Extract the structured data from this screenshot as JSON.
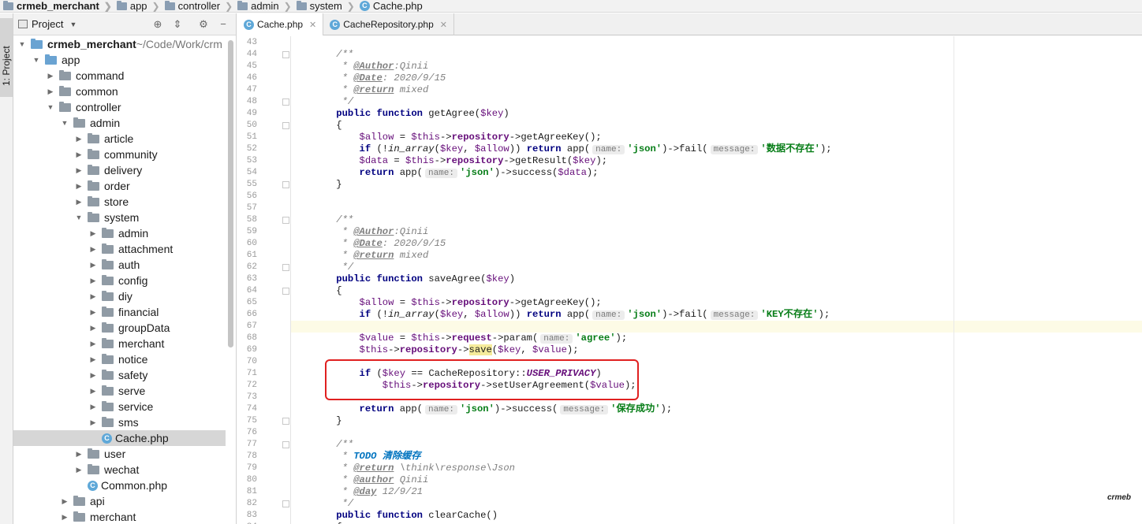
{
  "breadcrumb": [
    "crmeb_merchant",
    "app",
    "controller",
    "admin",
    "system",
    "Cache.php"
  ],
  "toolstrip": {
    "project_label": "1: Project"
  },
  "panel": {
    "title": "Project"
  },
  "tree": [
    {
      "label": "crmeb_merchant",
      "suffix": " ~/Code/Work/crm",
      "depth": 0,
      "arrow": "down",
      "type": "folder-blue",
      "bold": true
    },
    {
      "label": "app",
      "depth": 1,
      "arrow": "down",
      "type": "folder-blue"
    },
    {
      "label": "command",
      "depth": 2,
      "arrow": "right",
      "type": "folder"
    },
    {
      "label": "common",
      "depth": 2,
      "arrow": "right",
      "type": "folder"
    },
    {
      "label": "controller",
      "depth": 2,
      "arrow": "down",
      "type": "folder"
    },
    {
      "label": "admin",
      "depth": 3,
      "arrow": "down",
      "type": "folder"
    },
    {
      "label": "article",
      "depth": 4,
      "arrow": "right",
      "type": "folder"
    },
    {
      "label": "community",
      "depth": 4,
      "arrow": "right",
      "type": "folder"
    },
    {
      "label": "delivery",
      "depth": 4,
      "arrow": "right",
      "type": "folder"
    },
    {
      "label": "order",
      "depth": 4,
      "arrow": "right",
      "type": "folder"
    },
    {
      "label": "store",
      "depth": 4,
      "arrow": "right",
      "type": "folder"
    },
    {
      "label": "system",
      "depth": 4,
      "arrow": "down",
      "type": "folder"
    },
    {
      "label": "admin",
      "depth": 5,
      "arrow": "right",
      "type": "folder"
    },
    {
      "label": "attachment",
      "depth": 5,
      "arrow": "right",
      "type": "folder"
    },
    {
      "label": "auth",
      "depth": 5,
      "arrow": "right",
      "type": "folder"
    },
    {
      "label": "config",
      "depth": 5,
      "arrow": "right",
      "type": "folder"
    },
    {
      "label": "diy",
      "depth": 5,
      "arrow": "right",
      "type": "folder"
    },
    {
      "label": "financial",
      "depth": 5,
      "arrow": "right",
      "type": "folder"
    },
    {
      "label": "groupData",
      "depth": 5,
      "arrow": "right",
      "type": "folder"
    },
    {
      "label": "merchant",
      "depth": 5,
      "arrow": "right",
      "type": "folder"
    },
    {
      "label": "notice",
      "depth": 5,
      "arrow": "right",
      "type": "folder"
    },
    {
      "label": "safety",
      "depth": 5,
      "arrow": "right",
      "type": "folder"
    },
    {
      "label": "serve",
      "depth": 5,
      "arrow": "right",
      "type": "folder"
    },
    {
      "label": "service",
      "depth": 5,
      "arrow": "right",
      "type": "folder"
    },
    {
      "label": "sms",
      "depth": 5,
      "arrow": "right",
      "type": "folder"
    },
    {
      "label": "Cache.php",
      "depth": 5,
      "arrow": "none",
      "type": "php",
      "selected": true
    },
    {
      "label": "user",
      "depth": 4,
      "arrow": "right",
      "type": "folder"
    },
    {
      "label": "wechat",
      "depth": 4,
      "arrow": "right",
      "type": "folder"
    },
    {
      "label": "Common.php",
      "depth": 4,
      "arrow": "none",
      "type": "php"
    },
    {
      "label": "api",
      "depth": 3,
      "arrow": "right",
      "type": "folder"
    },
    {
      "label": "merchant",
      "depth": 3,
      "arrow": "right",
      "type": "folder"
    }
  ],
  "tabs": [
    {
      "label": "Cache.php",
      "active": true
    },
    {
      "label": "CacheRepository.php",
      "active": false
    }
  ],
  "code": [
    {
      "n": 43,
      "t": []
    },
    {
      "n": 44,
      "fold": true,
      "t": [
        [
          "    /**",
          "doc"
        ]
      ]
    },
    {
      "n": 45,
      "t": [
        [
          "     * ",
          "doc"
        ],
        [
          "@Author",
          "tag"
        ],
        [
          ":Qinii",
          "doc"
        ]
      ]
    },
    {
      "n": 46,
      "t": [
        [
          "     * ",
          "doc"
        ],
        [
          "@Date",
          "tag"
        ],
        [
          ": 2020/9/15",
          "doc"
        ]
      ]
    },
    {
      "n": 47,
      "t": [
        [
          "     * ",
          "doc"
        ],
        [
          "@return",
          "tag"
        ],
        [
          " mixed",
          "doc"
        ]
      ]
    },
    {
      "n": 48,
      "fold": true,
      "t": [
        [
          "     */",
          "doc"
        ]
      ]
    },
    {
      "n": 49,
      "t": [
        [
          "    ",
          ""
        ],
        [
          "public function",
          "kw"
        ],
        [
          " getAgree(",
          ""
        ],
        [
          "$key",
          "var"
        ],
        [
          ")",
          ""
        ]
      ]
    },
    {
      "n": 50,
      "fold": true,
      "t": [
        [
          "    {",
          ""
        ]
      ]
    },
    {
      "n": 51,
      "t": [
        [
          "        ",
          ""
        ],
        [
          "$allow",
          "var"
        ],
        [
          " = ",
          ""
        ],
        [
          "$this",
          "var"
        ],
        [
          "->",
          ""
        ],
        [
          "repository",
          "prop"
        ],
        [
          "->getAgreeKey();",
          ""
        ]
      ]
    },
    {
      "n": 52,
      "t": [
        [
          "        ",
          ""
        ],
        [
          "if",
          "kw"
        ],
        [
          " (!",
          ""
        ],
        [
          "in_array",
          "fn"
        ],
        [
          "(",
          ""
        ],
        [
          "$key",
          "var"
        ],
        [
          ", ",
          ""
        ],
        [
          "$allow",
          "var"
        ],
        [
          ")) ",
          ""
        ],
        [
          "return",
          "kw"
        ],
        [
          " app(",
          ""
        ],
        [
          "name:",
          "hint"
        ],
        [
          "'json'",
          "str"
        ],
        [
          ")->fail(",
          ""
        ],
        [
          "message:",
          "hint"
        ],
        [
          "'数据不存在'",
          "str"
        ],
        [
          ");",
          ""
        ]
      ]
    },
    {
      "n": 53,
      "t": [
        [
          "        ",
          ""
        ],
        [
          "$data",
          "var"
        ],
        [
          " = ",
          ""
        ],
        [
          "$this",
          "var"
        ],
        [
          "->",
          ""
        ],
        [
          "repository",
          "prop"
        ],
        [
          "->getResult(",
          ""
        ],
        [
          "$key",
          "var"
        ],
        [
          ");",
          ""
        ]
      ]
    },
    {
      "n": 54,
      "t": [
        [
          "        ",
          ""
        ],
        [
          "return",
          "kw"
        ],
        [
          " app(",
          ""
        ],
        [
          "name:",
          "hint"
        ],
        [
          "'json'",
          "str"
        ],
        [
          ")->success(",
          ""
        ],
        [
          "$data",
          "var"
        ],
        [
          ");",
          ""
        ]
      ]
    },
    {
      "n": 55,
      "fold": true,
      "t": [
        [
          "    }",
          ""
        ]
      ]
    },
    {
      "n": 56,
      "t": []
    },
    {
      "n": 57,
      "t": []
    },
    {
      "n": 58,
      "fold": true,
      "t": [
        [
          "    /**",
          "doc"
        ]
      ]
    },
    {
      "n": 59,
      "t": [
        [
          "     * ",
          "doc"
        ],
        [
          "@Author",
          "tag"
        ],
        [
          ":Qinii",
          "doc"
        ]
      ]
    },
    {
      "n": 60,
      "t": [
        [
          "     * ",
          "doc"
        ],
        [
          "@Date",
          "tag"
        ],
        [
          ": 2020/9/15",
          "doc"
        ]
      ]
    },
    {
      "n": 61,
      "t": [
        [
          "     * ",
          "doc"
        ],
        [
          "@return",
          "tag"
        ],
        [
          " mixed",
          "doc"
        ]
      ]
    },
    {
      "n": 62,
      "fold": true,
      "t": [
        [
          "     */",
          "doc"
        ]
      ]
    },
    {
      "n": 63,
      "t": [
        [
          "    ",
          ""
        ],
        [
          "public function",
          "kw"
        ],
        [
          " saveAgree(",
          ""
        ],
        [
          "$key",
          "var"
        ],
        [
          ")",
          ""
        ]
      ]
    },
    {
      "n": 64,
      "fold": true,
      "t": [
        [
          "    {",
          ""
        ]
      ]
    },
    {
      "n": 65,
      "t": [
        [
          "        ",
          ""
        ],
        [
          "$allow",
          "var"
        ],
        [
          " = ",
          ""
        ],
        [
          "$this",
          "var"
        ],
        [
          "->",
          ""
        ],
        [
          "repository",
          "prop"
        ],
        [
          "->getAgreeKey();",
          ""
        ]
      ]
    },
    {
      "n": 66,
      "t": [
        [
          "        ",
          ""
        ],
        [
          "if",
          "kw"
        ],
        [
          " (!",
          ""
        ],
        [
          "in_array",
          "fn"
        ],
        [
          "(",
          ""
        ],
        [
          "$key",
          "var"
        ],
        [
          ", ",
          ""
        ],
        [
          "$allow",
          "var"
        ],
        [
          ")) ",
          ""
        ],
        [
          "return",
          "kw"
        ],
        [
          " app(",
          ""
        ],
        [
          "name:",
          "hint"
        ],
        [
          "'json'",
          "str"
        ],
        [
          ")->fail(",
          ""
        ],
        [
          "message:",
          "hint"
        ],
        [
          "'KEY不存在'",
          "str"
        ],
        [
          ");",
          ""
        ]
      ]
    },
    {
      "n": 67,
      "t": []
    },
    {
      "n": 68,
      "t": [
        [
          "        ",
          ""
        ],
        [
          "$value",
          "var"
        ],
        [
          " = ",
          ""
        ],
        [
          "$this",
          "var"
        ],
        [
          "->",
          ""
        ],
        [
          "request",
          "prop"
        ],
        [
          "->param(",
          ""
        ],
        [
          "name:",
          "hint"
        ],
        [
          "'agree'",
          "str"
        ],
        [
          ");",
          ""
        ]
      ]
    },
    {
      "n": 69,
      "t": [
        [
          "        ",
          ""
        ],
        [
          "$this",
          "var"
        ],
        [
          "->",
          ""
        ],
        [
          "repository",
          "prop"
        ],
        [
          "->",
          ""
        ],
        [
          "save",
          "hi"
        ],
        [
          "(",
          ""
        ],
        [
          "$key",
          "var"
        ],
        [
          ", ",
          ""
        ],
        [
          "$value",
          "var"
        ],
        [
          ");",
          ""
        ]
      ]
    },
    {
      "n": 70,
      "t": []
    },
    {
      "n": 71,
      "t": [
        [
          "        ",
          ""
        ],
        [
          "if",
          "kw"
        ],
        [
          " (",
          ""
        ],
        [
          "$key",
          "var"
        ],
        [
          " == CacheRepository::",
          ""
        ],
        [
          "USER_PRIVACY",
          "const"
        ],
        [
          ")",
          ""
        ]
      ]
    },
    {
      "n": 72,
      "t": [
        [
          "            ",
          ""
        ],
        [
          "$this",
          "var"
        ],
        [
          "->",
          ""
        ],
        [
          "repository",
          "prop"
        ],
        [
          "->setUserAgreement(",
          ""
        ],
        [
          "$value",
          "var"
        ],
        [
          ");",
          ""
        ]
      ]
    },
    {
      "n": 73,
      "t": []
    },
    {
      "n": 74,
      "t": [
        [
          "        ",
          ""
        ],
        [
          "return",
          "kw"
        ],
        [
          " app(",
          ""
        ],
        [
          "name:",
          "hint"
        ],
        [
          "'json'",
          "str"
        ],
        [
          ")->success(",
          ""
        ],
        [
          "message:",
          "hint"
        ],
        [
          "'保存成功'",
          "str"
        ],
        [
          ");",
          ""
        ]
      ]
    },
    {
      "n": 75,
      "fold": true,
      "t": [
        [
          "    }",
          ""
        ]
      ]
    },
    {
      "n": 76,
      "t": []
    },
    {
      "n": 77,
      "fold": true,
      "t": [
        [
          "    /**",
          "doc"
        ]
      ]
    },
    {
      "n": 78,
      "t": [
        [
          "     * ",
          "doc"
        ],
        [
          "TODO 清除缓存",
          "todo"
        ]
      ]
    },
    {
      "n": 79,
      "t": [
        [
          "     * ",
          "doc"
        ],
        [
          "@return",
          "tag"
        ],
        [
          " \\think\\response\\Json",
          "doc"
        ]
      ]
    },
    {
      "n": 80,
      "t": [
        [
          "     * ",
          "doc"
        ],
        [
          "@author",
          "tag"
        ],
        [
          " Qinii",
          "doc"
        ]
      ]
    },
    {
      "n": 81,
      "t": [
        [
          "     * ",
          "doc"
        ],
        [
          "@day",
          "tag"
        ],
        [
          " 12/9/21",
          "doc"
        ]
      ]
    },
    {
      "n": 82,
      "fold": true,
      "t": [
        [
          "     */",
          "doc"
        ]
      ]
    },
    {
      "n": 83,
      "t": [
        [
          "    ",
          ""
        ],
        [
          "public function",
          "kw"
        ],
        [
          " clearCache()",
          ""
        ]
      ]
    },
    {
      "n": 84,
      "fold": true,
      "t": [
        [
          "    {",
          ""
        ]
      ]
    }
  ],
  "watermark": "crmeb"
}
